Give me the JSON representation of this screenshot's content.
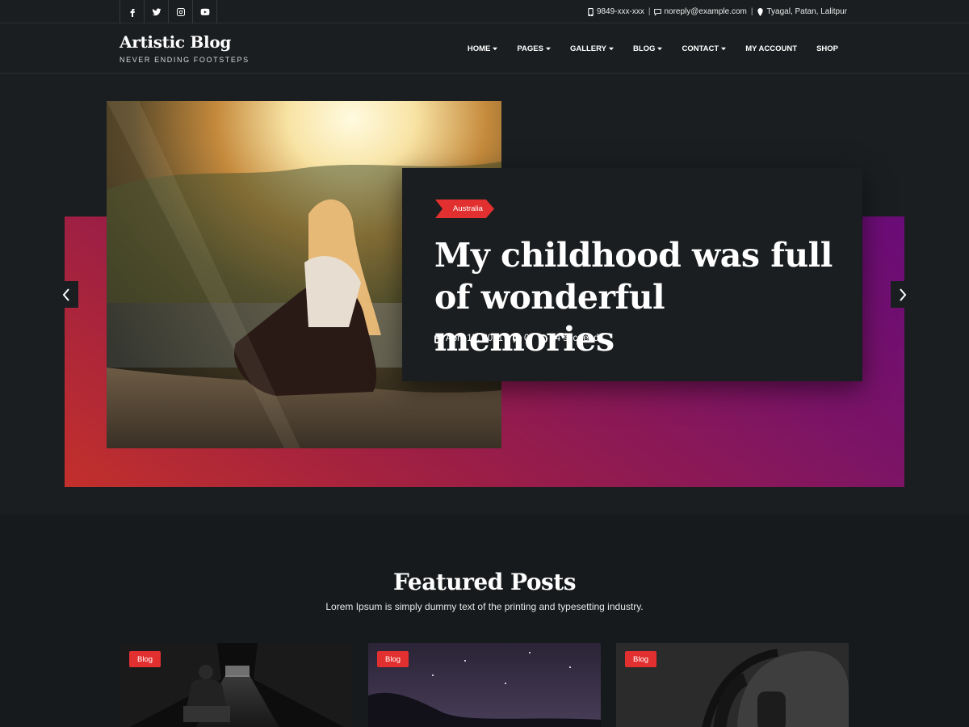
{
  "topbar": {
    "social": [
      {
        "icon": "facebook-icon"
      },
      {
        "icon": "twitter-icon"
      },
      {
        "icon": "instagram-icon"
      },
      {
        "icon": "youtube-icon"
      }
    ],
    "phone": "9849-xxx-xxx",
    "email": "noreply@example.com",
    "address": "Tyagal, Patan, Lalitpur",
    "separator": "|"
  },
  "header": {
    "site_title": "Artistic Blog",
    "tagline": "NEVER ENDING FOOTSTEPS"
  },
  "nav": {
    "items": [
      {
        "label": "HOME",
        "dropdown": true
      },
      {
        "label": "PAGES",
        "dropdown": true
      },
      {
        "label": "GALLERY",
        "dropdown": true
      },
      {
        "label": "BLOG",
        "dropdown": true
      },
      {
        "label": "CONTACT",
        "dropdown": true
      },
      {
        "label": "MY ACCOUNT",
        "dropdown": false
      },
      {
        "label": "SHOP",
        "dropdown": false
      }
    ]
  },
  "hero": {
    "category": "Australia",
    "title": "My childhood was full of wonderful memories",
    "date": "April 15, 2021",
    "comments": "0",
    "read_time": "24 sec read",
    "prev_icon": "chevron-left-icon",
    "next_icon": "chevron-right-icon"
  },
  "featured": {
    "title": "Featured Posts",
    "subtitle": "Lorem Ipsum is simply dummy text of the printing and typesetting industry.",
    "cards": [
      {
        "badge": "Blog"
      },
      {
        "badge": "Blog"
      },
      {
        "badge": "Blog"
      }
    ]
  },
  "colors": {
    "accent": "#e1302f",
    "background": "#1b1e20",
    "gradient_start": "#c2302b",
    "gradient_end": "#6a0c78"
  }
}
